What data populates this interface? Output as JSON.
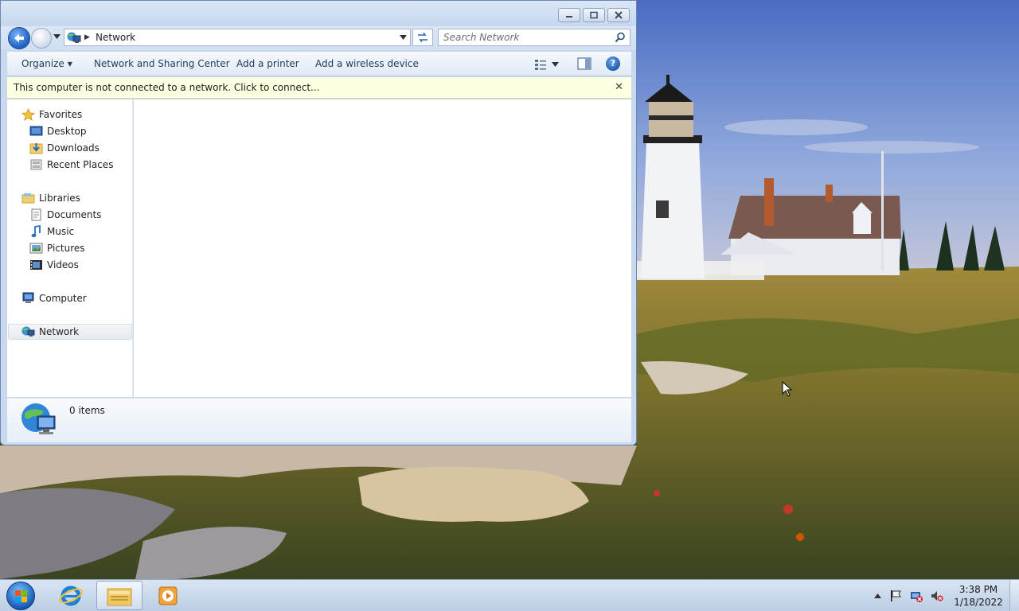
{
  "window": {
    "address": {
      "crumb": "Network"
    },
    "search": {
      "placeholder": "Search Network"
    },
    "commands": {
      "organize": "Organize",
      "network_sharing": "Network and Sharing Center",
      "add_printer": "Add a printer",
      "add_wireless": "Add a wireless device"
    },
    "infobar": {
      "message": "This computer is not connected to a network. Click to connect..."
    },
    "nav": {
      "favorites": "Favorites",
      "desktop": "Desktop",
      "downloads": "Downloads",
      "recent_places": "Recent Places",
      "libraries": "Libraries",
      "documents": "Documents",
      "music": "Music",
      "pictures": "Pictures",
      "videos": "Videos",
      "computer": "Computer",
      "network": "Network"
    },
    "details": {
      "count": "0 items"
    }
  },
  "taskbar": {
    "clock": {
      "time": "3:38 PM",
      "date": "1/18/2022"
    }
  },
  "colors": {
    "infobar_bg": "#ffffe1",
    "window_frame": "#c9d8ec",
    "accent": "#1c5aad"
  }
}
